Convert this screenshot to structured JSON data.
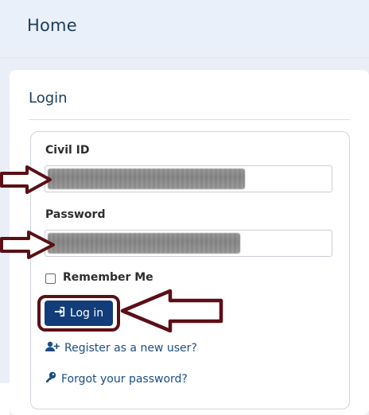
{
  "header": {
    "title": "Home"
  },
  "login": {
    "title": "Login",
    "civil_id": {
      "label": "Civil ID",
      "value": ""
    },
    "password": {
      "label": "Password",
      "value": ""
    },
    "remember_label": "Remember Me",
    "login_button": "Log in",
    "register_link": "Register as a new user?",
    "forgot_link": "Forgot your password?"
  },
  "colors": {
    "primary_button": "#123c7a",
    "annotation_arrow": "#5b0f16",
    "link": "#1b4d85"
  },
  "icons": {
    "login_icon": "sign-in-icon",
    "register_icon": "user-plus-icon",
    "forgot_icon": "key-icon"
  }
}
